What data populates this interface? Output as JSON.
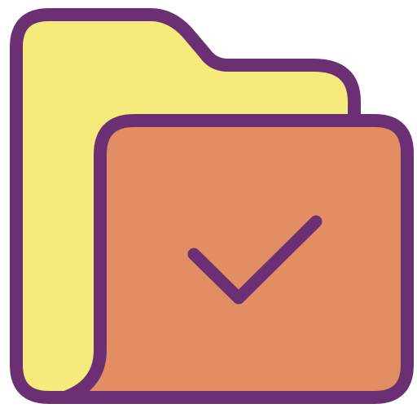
{
  "icon": {
    "name": "folder-check-icon",
    "colors": {
      "outline": "#6B2F74",
      "back_folder": "#F7EA7C",
      "front_folder": "#E38D63",
      "background": "#FFFFFF"
    }
  }
}
